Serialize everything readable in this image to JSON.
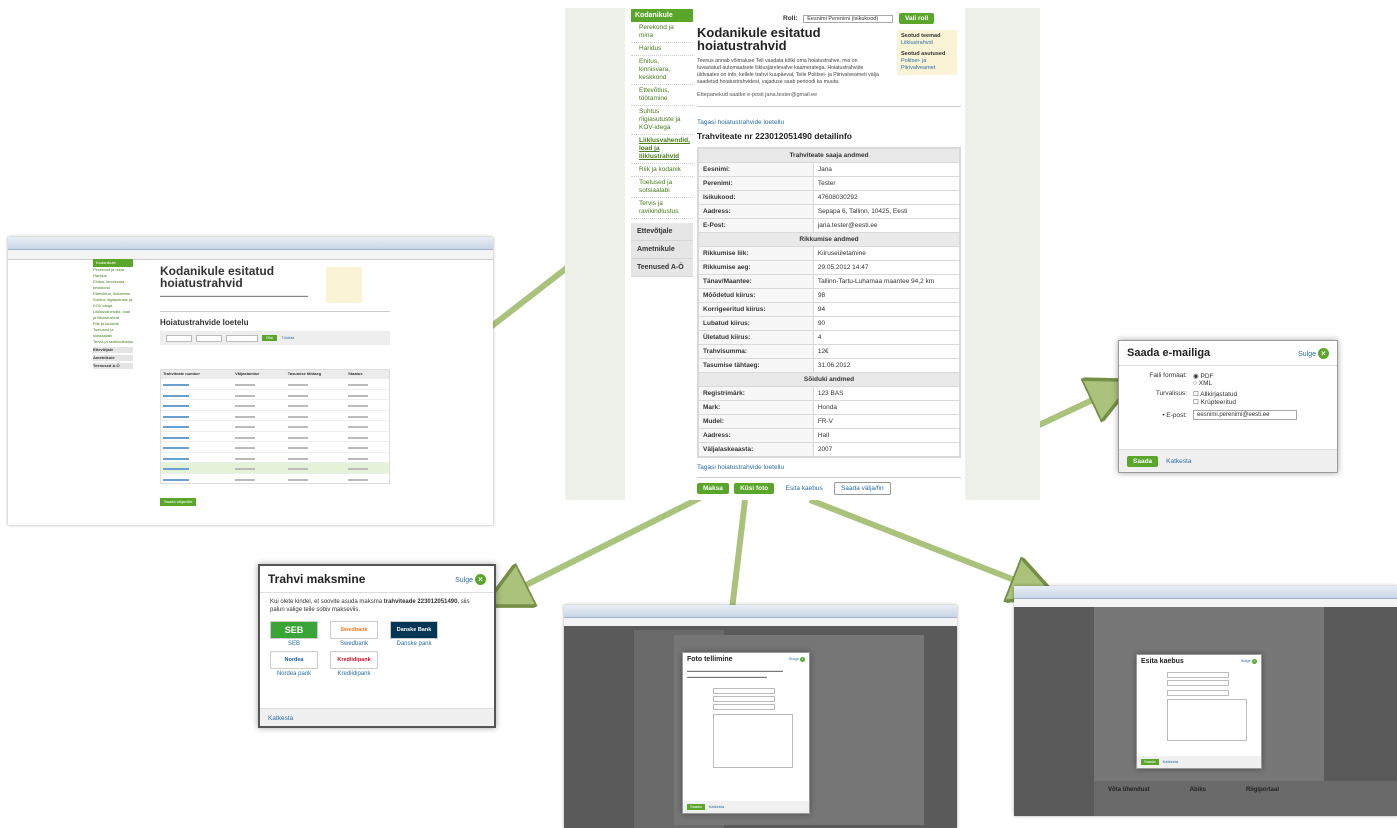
{
  "main": {
    "site_tab": "Kodanikule",
    "role_label": "Roll:",
    "role_value": "Eesnimi Perenimi (isikukood)",
    "role_button": "Vali roll",
    "nav": [
      "Perekond ja mina",
      "Haridus",
      "Ehitus, kinnisvara, keskkond",
      "Ettevõtlus, töötamine",
      "Suhtus riigiasutuste ja KOV-idega",
      "Liiklusvahendid, load ja liiklustrahvid",
      "Riik ja kodanik",
      "Toetused ja sotsiaalabi",
      "Tervis ja ravikindlustus"
    ],
    "nav_groups": [
      "Ettevõtjale",
      "Ametnikule",
      "Teenused A-Ö"
    ],
    "title": "Kodanikule esitatud hoiatustrahvid",
    "intro": "Teenus annab võimaluse Teil vaadata kõiki oma hoiatustrahve, mis on tuvastatud automaatsete liiklusjärelevalve kaameratega. Hoiatustrahvide üldvaates on info, kellele trahvi kuupäeval, Teile Politsei- ja Piirivalveameti välja saadetud hoiatustrahvidest, vajaduse saab perioodi ka muuta.",
    "contact": "Ettepanekud saatke e-posti jana.tester@gmail.ee",
    "side_box": {
      "h1": "Seotud teemad",
      "l1": "Liiklustrahvid",
      "h2": "Seotud asutused",
      "l2": "Politsei- ja Piirivalveamet"
    },
    "back_link": "Tagasi hoiatustrahvide loetellu",
    "detail_title": "Trahviteate nr 223012051490 detailinfo",
    "sections": [
      {
        "title": "Trahviteate saaja andmed",
        "rows": [
          [
            "Eesnimi:",
            "Jana"
          ],
          [
            "Perenimi:",
            "Tester"
          ],
          [
            "Isikukood:",
            "47608030292"
          ],
          [
            "Aadress:",
            "Sepapa 6, Tallinn, 10425, Eesti"
          ],
          [
            "E-Post:",
            "jana.tester@eesti.ee"
          ]
        ]
      },
      {
        "title": "Rikkumise andmed",
        "rows": [
          [
            "Rikkumise liik:",
            "Kiiruseületamine"
          ],
          [
            "Rikkumise aeg:",
            "29.05.2012 14:47"
          ],
          [
            "Tänav/Maantee:",
            "Tallinn-Tartu-Luhamaa maantee 94,2 km"
          ],
          [
            "Mõõdetud kiirus:",
            "98"
          ],
          [
            "Korrigeeritud kiirus:",
            "94"
          ],
          [
            "Lubatud kiirus:",
            "90"
          ],
          [
            "Ületatud kiirus:",
            "4"
          ],
          [
            "Trahvisumma:",
            "12€"
          ],
          [
            "Tasumise tähtaeg:",
            "31.06.2012"
          ]
        ]
      },
      {
        "title": "Sõiduki andmed",
        "rows": [
          [
            "Registrimärk:",
            "123 BAS"
          ],
          [
            "Mark:",
            "Honda"
          ],
          [
            "Mudel:",
            "FR-V"
          ],
          [
            "Aadress:",
            "Hall"
          ],
          [
            "Väljalaskeaasta:",
            "2007"
          ]
        ]
      }
    ],
    "buttons": [
      "Maksa",
      "Küsi foto",
      "Esita kaebus",
      "Saada välja/fin"
    ]
  },
  "list_page": {
    "title": "Kodanikule esitatud hoiatustrahvid",
    "list_heading": "Hoiatustrahvide loetelu",
    "filter_button": "Otsi",
    "filter_link": "Tühista",
    "columns": [
      "Trahviteate number",
      "Väljastamise",
      "Tasumise tähtaeg",
      "Staatus"
    ],
    "rows": 10,
    "bottom_button": "Saada väljavõte"
  },
  "email_dialog": {
    "title": "Saada e-mailiga",
    "close_label": "Sulge",
    "format_label": "Faili formaat:",
    "format_options": [
      "PDF",
      "XML"
    ],
    "signing_label": "Turvalisus:",
    "signing_options": [
      "Allkirjastatud",
      "Krüpteeritud"
    ],
    "email_label": "• E-post:",
    "email_value": "eesnimi.perenimi@eesti.ee",
    "send_button": "Saada",
    "cancel_link": "Katkesta"
  },
  "pay_dialog": {
    "title": "Trahvi maksmine",
    "close_label": "Sulge",
    "text_pre": "Kui olete kindel, et soovite asuda maksma ",
    "text_bold": "trahviteade 223012051490",
    "text_post": ", siis palun valige teile sobiv makseviis.",
    "banks": [
      {
        "logo": "SEB",
        "name": "SEB",
        "color": "#3aa537"
      },
      {
        "logo": "Swedbank",
        "name": "Swedbank",
        "color": "#f47b20"
      },
      {
        "logo": "Danske Bank",
        "name": "Danske pank",
        "color": "#003755"
      },
      {
        "logo": "Nordea",
        "name": "Nordea pank",
        "color": "#1b5ea6"
      },
      {
        "logo": "Krediidipank",
        "name": "Krediidipank",
        "color": "#c8102e"
      }
    ],
    "cancel_link": "Katkesta"
  },
  "photo_dialog": {
    "title": "Foto tellimine",
    "close_label": "Sulge",
    "send": "Saada",
    "cancel": "Katkesta"
  },
  "complaint_dialog": {
    "title": "Esita kaebus",
    "close_label": "Sulge",
    "send": "Saada",
    "cancel": "Katkesta"
  },
  "footer_cols": [
    "Võta ühendust",
    "Abiks",
    "Riigiportaal"
  ]
}
